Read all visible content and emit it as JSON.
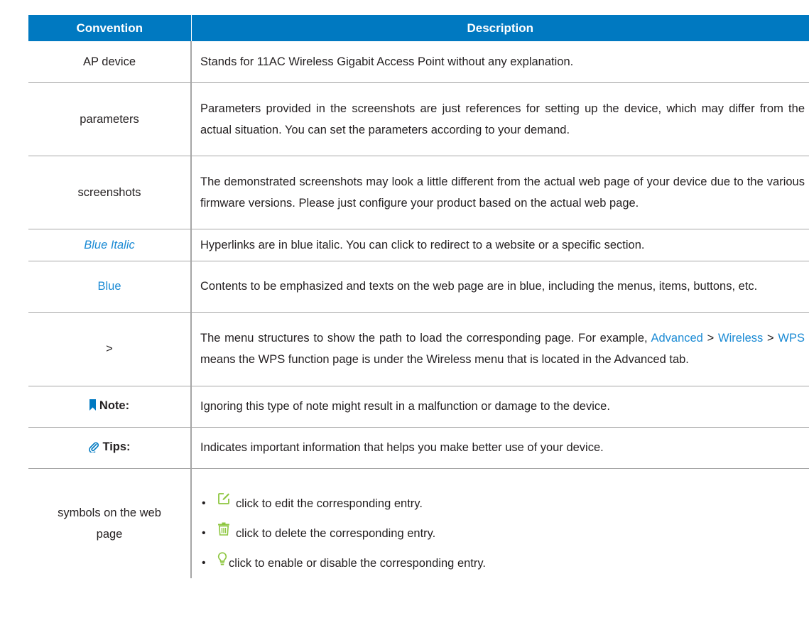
{
  "header": {
    "convention": "Convention",
    "description": "Description"
  },
  "rows": {
    "ap_device": {
      "convention": "AP device",
      "description": "Stands for 11AC Wireless Gigabit Access Point without any explanation."
    },
    "parameters": {
      "convention": "parameters",
      "description": "Parameters provided in the screenshots are just references for setting up the device, which may differ from the actual situation. You can set the parameters according to your demand."
    },
    "screenshots": {
      "convention": "screenshots",
      "description": "The demonstrated screenshots may look a little different from the actual web page of your device due to the various firmware versions. Please just configure your product based on the actual web page."
    },
    "blue_italic": {
      "convention": "Blue Italic",
      "description": "Hyperlinks are in blue italic. You can click to redirect to a website or a specific section."
    },
    "blue": {
      "convention": "Blue",
      "description": "Contents to be emphasized and texts on the web page are in blue, including the menus, items, buttons, etc."
    },
    "menu_path": {
      "convention": ">",
      "description_before": "The menu structures to show the path to load the corresponding page. For example, ",
      "path_advanced": "Advanced",
      "sep1": " > ",
      "path_wireless": "Wireless",
      "sep2": " > ",
      "path_wps": "WPS",
      "description_after": " means the WPS function page is under the Wireless menu that is located in the Advanced tab."
    },
    "note": {
      "convention": "Note:",
      "description": "Ignoring this type of note might result in a malfunction or damage to the device."
    },
    "tips": {
      "convention": "Tips:",
      "description": "Indicates important information that helps you make better use of your device."
    },
    "symbols": {
      "convention": "symbols on the web page",
      "items": [
        {
          "bullet": "•",
          "icon": "edit-icon",
          "text": "click to edit the corresponding entry."
        },
        {
          "bullet": "•",
          "icon": "trash-icon",
          "text": "click to delete the corresponding entry."
        },
        {
          "bullet": "•",
          "icon": "bulb-icon",
          "text": "click to enable or disable the corresponding entry."
        }
      ]
    }
  },
  "colors": {
    "header_bg": "#0079c1",
    "link_blue": "#1a8ad4",
    "icon_green": "#8dc63f",
    "rule_gray": "#a6a6a6"
  }
}
